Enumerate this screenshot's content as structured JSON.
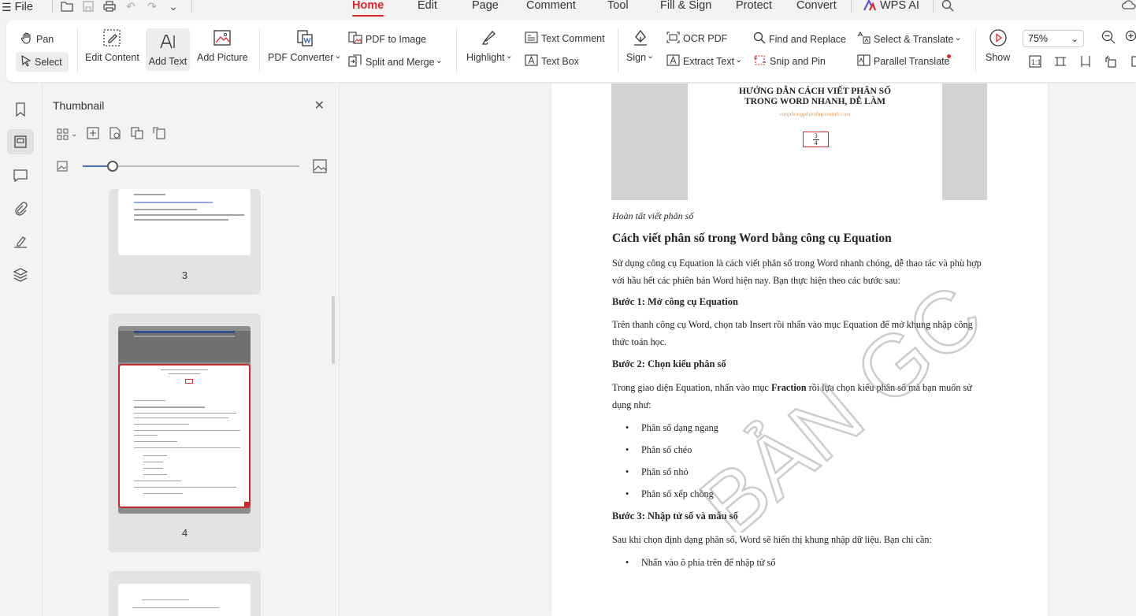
{
  "menubar": {
    "file_label": "File",
    "tabs": [
      "Home",
      "Edit",
      "Page",
      "Comment",
      "Tool",
      "Fill & Sign",
      "Protect",
      "Convert",
      "WPS AI"
    ],
    "active_tab": "Home"
  },
  "ribbon": {
    "pan": "Pan",
    "select": "Select",
    "edit_content": "Edit Content",
    "add_text": "Add Text",
    "add_picture": "Add Picture",
    "pdf_converter": "PDF Converter",
    "pdf_to_image": "PDF to Image",
    "split_merge": "Split and Merge",
    "highlight": "Highlight",
    "text_comment": "Text Comment",
    "text_box": "Text Box",
    "sign": "Sign",
    "ocr_pdf": "OCR PDF",
    "extract_text": "Extract Text",
    "find_replace": "Find and Replace",
    "snip_pin": "Snip and Pin",
    "select_translate": "Select & Translate",
    "parallel_translate": "Parallel Translate",
    "show": "Show",
    "zoom": "75%"
  },
  "thumbnail_panel": {
    "title": "Thumbnail",
    "pages": [
      "3",
      "4"
    ]
  },
  "document": {
    "hero_title": "HƯỚNG DẪN CÁCH VIẾT PHÂN SỐ TRONG WORD NHANH, DỄ LÀM",
    "hero_url": "vanphongphamhuyenanh.com",
    "hero_frac_num": "3",
    "hero_frac_den": "4",
    "caption": "Hoàn tất viết phân số",
    "heading": "Cách viết phân số trong Word bằng công cụ Equation",
    "intro": "Sử dụng công cụ Equation là cách viết phân số trong Word nhanh chóng, dễ thao tác và phù hợp với hầu hết các phiên bản Word hiện nay. Bạn thực hiện theo các bước sau:",
    "step1_title": "Bước 1: Mở công cụ Equation",
    "step1_text": "Trên thanh công cụ Word, chọn tab Insert rồi nhấn vào mục Equation để mở khung nhập công thức toán học.",
    "step2_title": "Bước 2: Chọn kiểu phân số",
    "step2_pre": "Trong giao diện Equation, nhấn vào mục ",
    "step2_bold": "Fraction",
    "step2_post": " rồi lựa chọn kiểu phân số mà bạn muốn sử dụng như:",
    "bullets": [
      "Phân số dạng ngang",
      "Phân số chéo",
      "Phân số nhỏ",
      "Phân số xếp chồng"
    ],
    "step3_title": "Bước 3: Nhập tử số và mẫu số",
    "step3_text": "Sau khi chọn định dạng phân số, Word sẽ hiển thị khung nhập dữ liệu. Bạn chỉ cần:",
    "step3_bullet": "Nhấn vào ô phía trên để nhập tử số",
    "watermark": "BẢN GC"
  },
  "colors": {
    "accent": "#d6282d",
    "slider": "#4a6fb3"
  }
}
